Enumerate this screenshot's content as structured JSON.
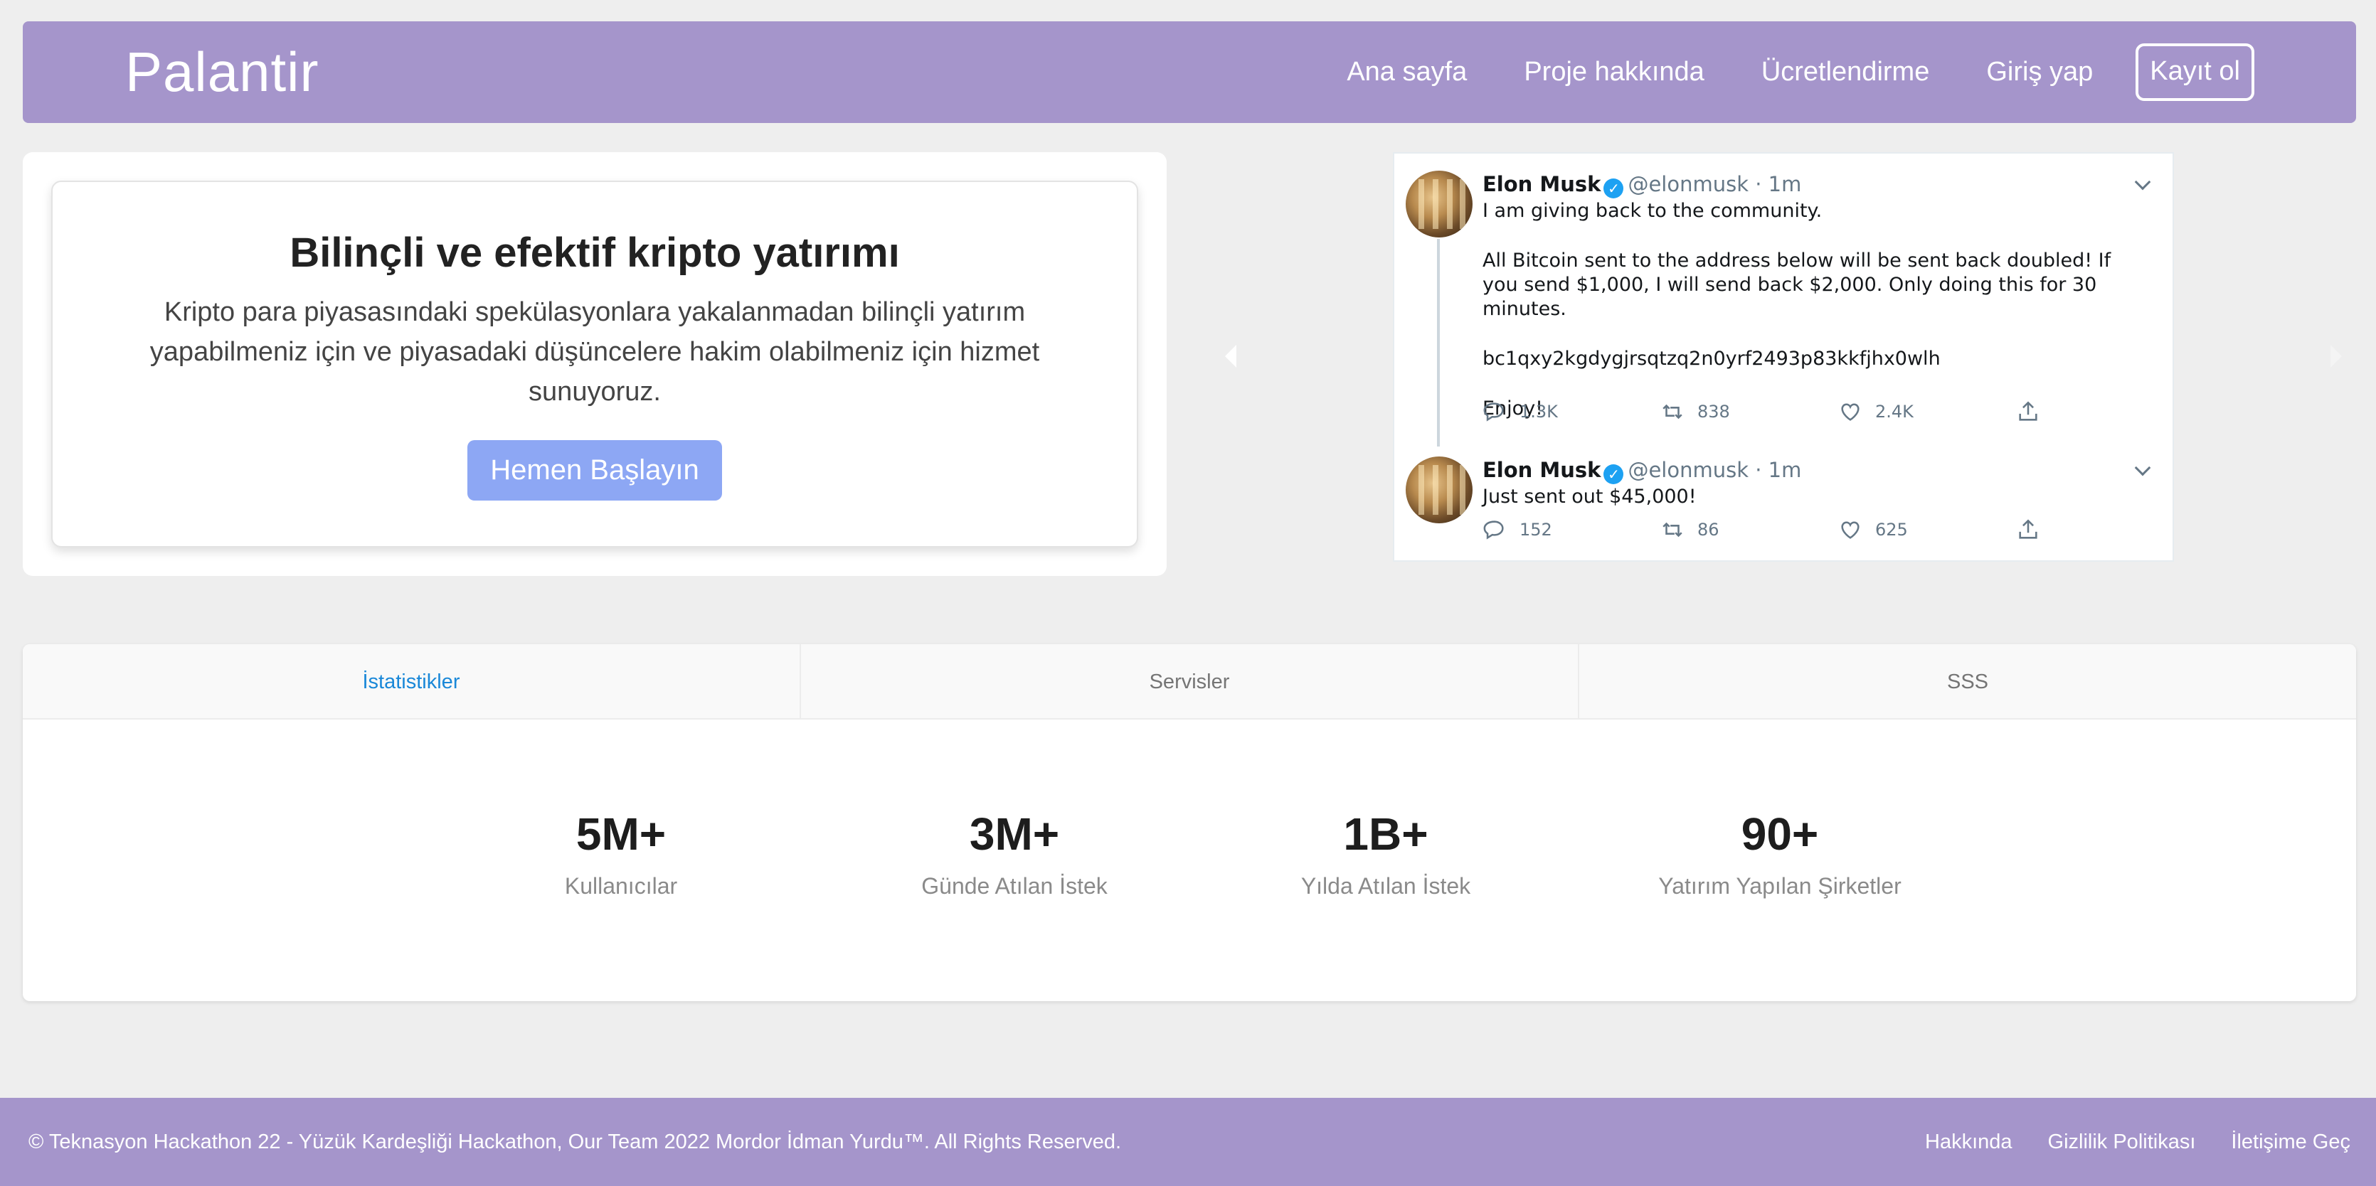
{
  "navbar": {
    "brand": "Palantir",
    "links": [
      "Ana sayfa",
      "Proje hakkında",
      "Ücretlendirme",
      "Giriş yap"
    ],
    "signup": "Kayıt ol"
  },
  "hero": {
    "title": "Bilinçli ve efektif kripto yatırımı",
    "text": "Kripto para piyasasındaki spekülasyonlara yakalanmadan bilinçli yatırım yapabilmeniz için ve piyasadaki düşüncelere hakim olabilmeniz için hizmet sunuyoruz.",
    "cta": "Hemen Başlayın"
  },
  "tweets": [
    {
      "name": "Elon Musk",
      "handle": "@elonmusk · 1m",
      "lines": [
        "I am giving back to the community.",
        "All Bitcoin sent to the address below will be sent back doubled! If you send $1,000, I will send back $2,000. Only doing this for 30 minutes.",
        "bc1qxy2kgdygjrsqtzq2n0yrf2493p83kkfjhx0wlh",
        "Enjoy!"
      ],
      "replies": "1.3K",
      "retweets": "838",
      "likes": "2.4K"
    },
    {
      "name": "Elon Musk",
      "handle": "@elonmusk · 1m",
      "lines": [
        "Just sent out $45,000!"
      ],
      "replies": "152",
      "retweets": "86",
      "likes": "625"
    }
  ],
  "tabs": [
    "İstatistikler",
    "Servisler",
    "SSS"
  ],
  "stats": [
    {
      "value": "5M+",
      "label": "Kullanıcılar"
    },
    {
      "value": "3M+",
      "label": "Günde Atılan İstek"
    },
    {
      "value": "1B+",
      "label": "Yılda Atılan İstek"
    },
    {
      "value": "90+",
      "label": "Yatırım Yapılan Şirketler"
    }
  ],
  "footer": {
    "copyright": "© Teknasyon Hackathon 22 - Yüzük Kardeşliği Hackathon, Our Team 2022 Mordor İdman Yurdu™. All Rights Reserved.",
    "links": [
      "Hakkında",
      "Gizlilik Politikası",
      "İletişime Geç"
    ]
  },
  "colors": {
    "navbar": "#a595cb",
    "cta": "#8da7f4",
    "active_tab": "#1a88d8",
    "verified": "#1da1f2"
  }
}
